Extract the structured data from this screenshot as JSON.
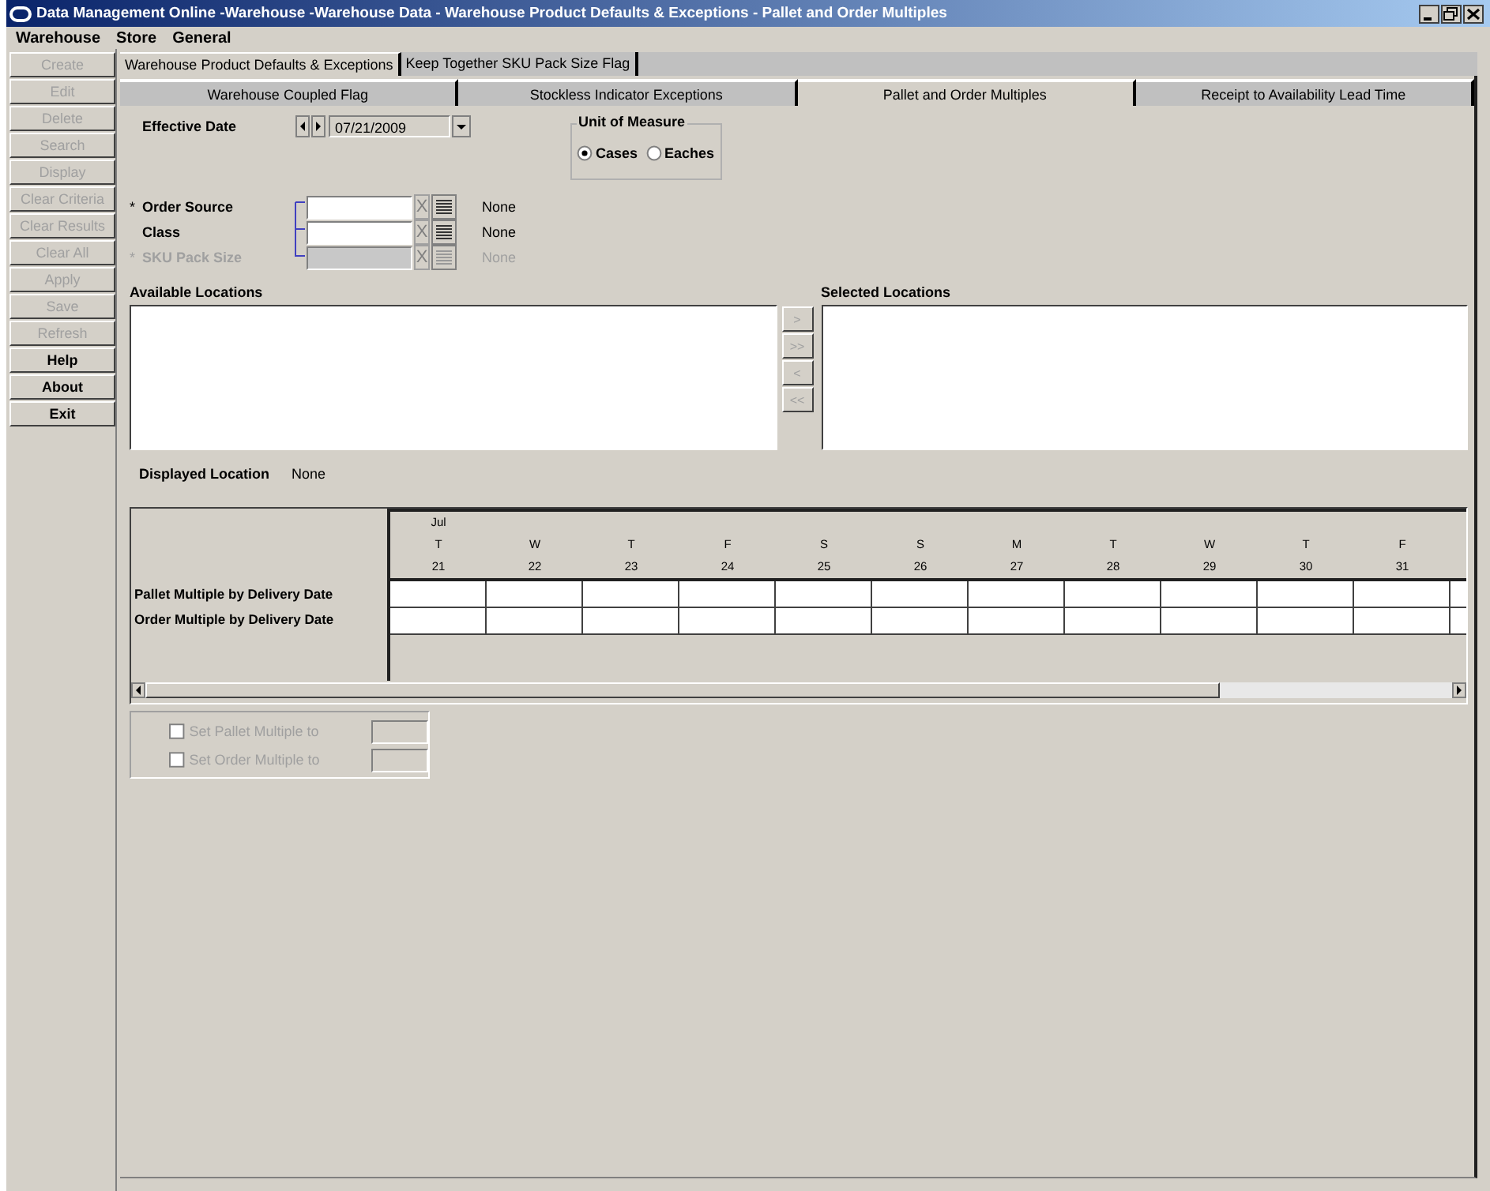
{
  "window": {
    "title": "Data Management Online -Warehouse -Warehouse Data - Warehouse Product Defaults & Exceptions - Pallet and Order Multiples"
  },
  "menu": [
    "Warehouse",
    "Store",
    "General"
  ],
  "sidebar": [
    {
      "label": "Create",
      "disabled": true
    },
    {
      "label": "Edit",
      "disabled": true
    },
    {
      "label": "Delete",
      "disabled": true
    },
    {
      "label": "Search",
      "disabled": true
    },
    {
      "label": "Display",
      "disabled": true
    },
    {
      "label": "Clear Criteria",
      "disabled": true
    },
    {
      "label": "Clear Results",
      "disabled": true
    },
    {
      "label": "Clear All",
      "disabled": true
    },
    {
      "label": "Apply",
      "disabled": true
    },
    {
      "label": "Save",
      "disabled": true
    },
    {
      "label": "Refresh",
      "disabled": true
    },
    {
      "label": "Help",
      "disabled": false
    },
    {
      "label": "About",
      "disabled": false
    },
    {
      "label": "Exit",
      "disabled": false
    }
  ],
  "tabs": [
    {
      "label": "Warehouse Product Defaults & Exceptions",
      "selected": true
    },
    {
      "label": "Keep Together SKU Pack Size Flag",
      "selected": false
    }
  ],
  "subtabs": [
    {
      "label": "Warehouse Coupled Flag",
      "selected": false
    },
    {
      "label": "Stockless Indicator Exceptions",
      "selected": false
    },
    {
      "label": "Pallet and Order Multiples",
      "selected": true
    },
    {
      "label": "Receipt to Availability Lead Time",
      "selected": false
    }
  ],
  "effective_date": {
    "label": "Effective Date",
    "value": "07/21/2009"
  },
  "unit_of_measure": {
    "title": "Unit of Measure",
    "options": [
      {
        "label": "Cases",
        "selected": true
      },
      {
        "label": "Eaches",
        "selected": false
      }
    ]
  },
  "required_mark": "*",
  "criteria": [
    {
      "label": "Order Source",
      "required": true,
      "disabled": false,
      "clear": "X",
      "description": "None"
    },
    {
      "label": "Class",
      "required": false,
      "disabled": false,
      "clear": "X",
      "description": "None"
    },
    {
      "label": "SKU Pack Size",
      "required": true,
      "disabled": true,
      "clear": "X",
      "description": "None"
    }
  ],
  "available_locations": {
    "label": "Available Locations"
  },
  "selected_locations": {
    "label": "Selected Locations"
  },
  "move_buttons": [
    {
      "label": ">",
      "disabled": true
    },
    {
      "label": ">>",
      "disabled": true
    },
    {
      "label": "<",
      "disabled": true
    },
    {
      "label": "<<",
      "disabled": true
    }
  ],
  "displayed_location": {
    "label": "Displayed Location",
    "value": "None"
  },
  "grid": {
    "month": "Jul",
    "days": [
      {
        "dow": "T",
        "day": "21"
      },
      {
        "dow": "W",
        "day": "22"
      },
      {
        "dow": "T",
        "day": "23"
      },
      {
        "dow": "F",
        "day": "24"
      },
      {
        "dow": "S",
        "day": "25"
      },
      {
        "dow": "S",
        "day": "26"
      },
      {
        "dow": "M",
        "day": "27"
      },
      {
        "dow": "T",
        "day": "28"
      },
      {
        "dow": "W",
        "day": "29"
      },
      {
        "dow": "T",
        "day": "30"
      },
      {
        "dow": "F",
        "day": "31"
      }
    ],
    "rows": [
      "Pallet Multiple by Delivery Date",
      "Order Multiple by Delivery Date"
    ]
  },
  "set_options": [
    {
      "label": "Set Pallet Multiple to",
      "checked": false,
      "disabled": true
    },
    {
      "label": "Set Order Multiple to",
      "checked": false,
      "disabled": true
    }
  ]
}
